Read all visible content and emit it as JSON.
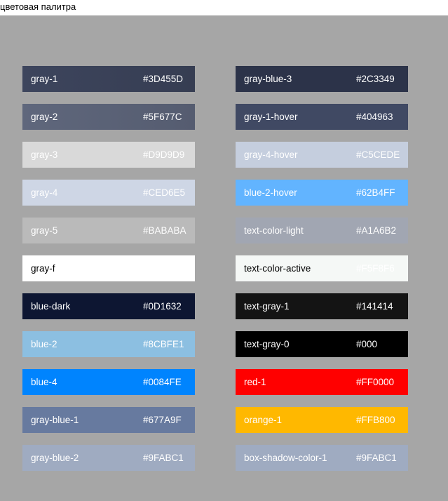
{
  "header": {
    "title": "цветовая палитра"
  },
  "palette": {
    "left": [
      {
        "name": "gray-1",
        "hex": "#3D455D",
        "color": "#3D455D",
        "text_color": "#FFFFFF",
        "gradient_to": "#363D52"
      },
      {
        "name": "gray-2",
        "hex": "#5F677C",
        "color": "#5F677C",
        "text_color": "#FFFFFF",
        "gradient_to": "#555C70"
      },
      {
        "name": "gray-3",
        "hex": "#D9D9D9",
        "color": "#D9D9D9",
        "text_color": "#FFFFFF"
      },
      {
        "name": "gray-4",
        "hex": "#CED6E5",
        "color": "#CED6E5",
        "text_color": "#FFFFFF"
      },
      {
        "name": "gray-5",
        "hex": "#BABABA",
        "color": "#BABABA",
        "text_color": "#FFFFFF"
      },
      {
        "name": "gray-f",
        "hex": "",
        "color": "#FFFFFF",
        "text_color": "#000000"
      },
      {
        "name": "blue-dark",
        "hex": "#0D1632",
        "color": "#0D1632",
        "text_color": "#FFFFFF"
      },
      {
        "name": "blue-2",
        "hex": "#8CBFE1",
        "color": "#8CBFE1",
        "text_color": "#FFFFFF"
      },
      {
        "name": "blue-4",
        "hex": "#0084FE",
        "color": "#0084FE",
        "text_color": "#FFFFFF"
      },
      {
        "name": "gray-blue-1",
        "hex": "#677A9F",
        "color": "#677A9F",
        "text_color": "#FFFFFF"
      },
      {
        "name": "gray-blue-2",
        "hex": "#9FABC1",
        "color": "#9FABC1",
        "text_color": "#FFFFFF"
      }
    ],
    "right": [
      {
        "name": "gray-blue-3",
        "hex": "#2C3349",
        "color": "#2C3349",
        "text_color": "#FFFFFF"
      },
      {
        "name": "gray-1-hover",
        "hex": "#404963",
        "color": "#404963",
        "text_color": "#FFFFFF"
      },
      {
        "name": "gray-4-hover",
        "hex": "#C5CEDE",
        "color": "#C5CEDE",
        "text_color": "#FFFFFF"
      },
      {
        "name": "blue-2-hover",
        "hex": "#62B4FF",
        "color": "#62B4FF",
        "text_color": "#FFFFFF"
      },
      {
        "name": "text-color-light",
        "hex": "#A1A6B2",
        "color": "#A1A6B2",
        "text_color": "#FFFFFF"
      },
      {
        "name": "text-color-active",
        "hex": "#F5F8F6",
        "color": "#F5F8F6",
        "text_color": "#000000",
        "hex_color": "#FFFFFF"
      },
      {
        "name": "text-gray-1",
        "hex": "#141414",
        "color": "#141414",
        "text_color": "#FFFFFF"
      },
      {
        "name": "text-gray-0",
        "hex": "#000",
        "color": "#000000",
        "text_color": "#FFFFFF"
      },
      {
        "name": "red-1",
        "hex": "#FF0000",
        "color": "#FF0000",
        "text_color": "#FFFFFF"
      },
      {
        "name": "orange-1",
        "hex": "#FFB800",
        "color": "#FFB800",
        "text_color": "#FFFFFF"
      },
      {
        "name": "box-shadow-color-1",
        "hex": "#9FABC1",
        "color": "#9FABC1",
        "text_color": "#FFFFFF"
      }
    ]
  }
}
